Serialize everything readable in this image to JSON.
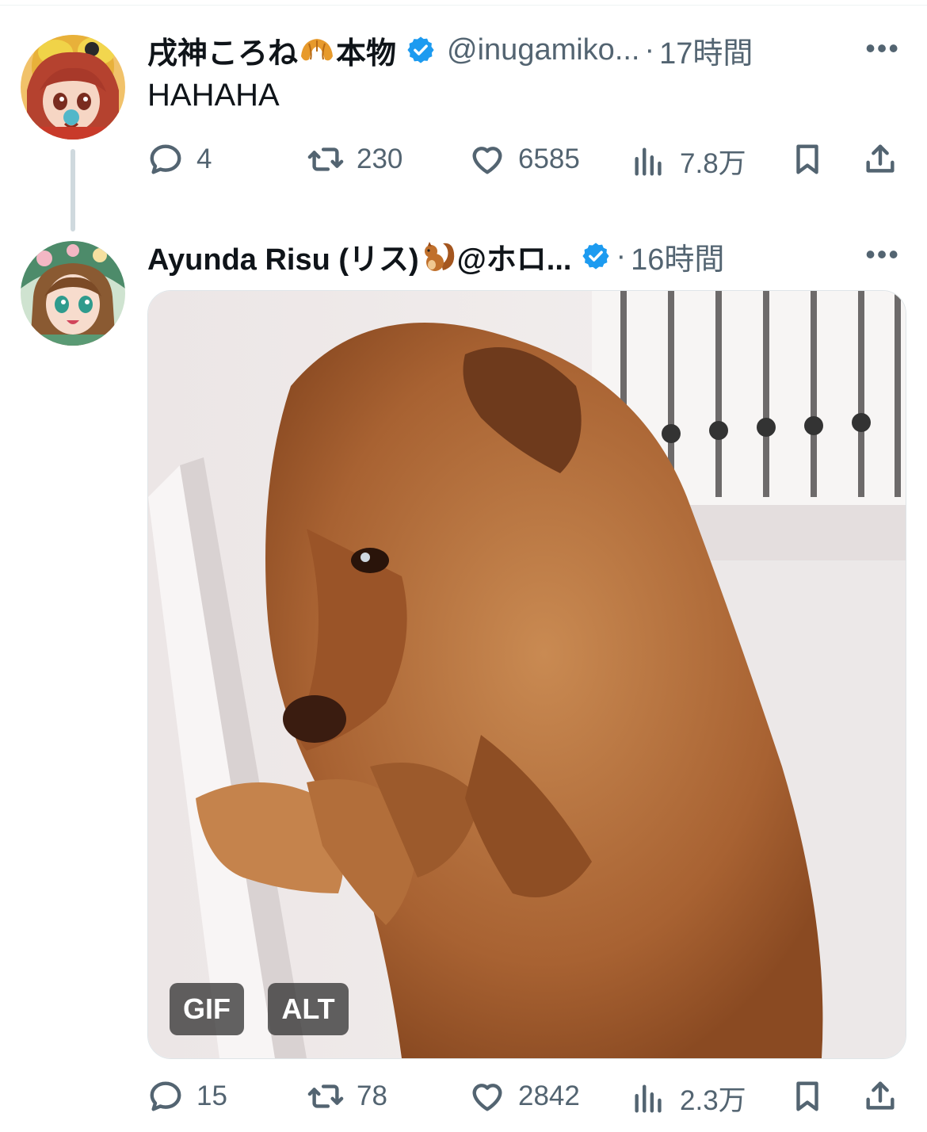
{
  "tweets": [
    {
      "name": "戌神ころね",
      "name_emoji": "croissant",
      "name_suffix": "本物",
      "handle": "@inugamiko...",
      "time": "17時間",
      "text": "HAHAHA",
      "stats": {
        "replies": "4",
        "retweets": "230",
        "likes": "6585",
        "views": "7.8万"
      }
    },
    {
      "name": "Ayunda Risu (リス)",
      "name_emoji": "squirrel",
      "name_suffix": "@ホロ...",
      "time": "16時間",
      "media": {
        "badge_gif": "GIF",
        "badge_alt": "ALT"
      },
      "stats": {
        "replies": "15",
        "retweets": "78",
        "likes": "2842",
        "views": "2.3万"
      }
    }
  ],
  "colors": {
    "verified": "#1d9bf0",
    "muted_text": "#536471",
    "thread_line": "#cfd9de"
  },
  "icons": [
    "verified-badge-icon",
    "more-icon",
    "reply-icon",
    "retweet-icon",
    "like-icon",
    "views-icon",
    "bookmark-icon",
    "share-icon"
  ]
}
